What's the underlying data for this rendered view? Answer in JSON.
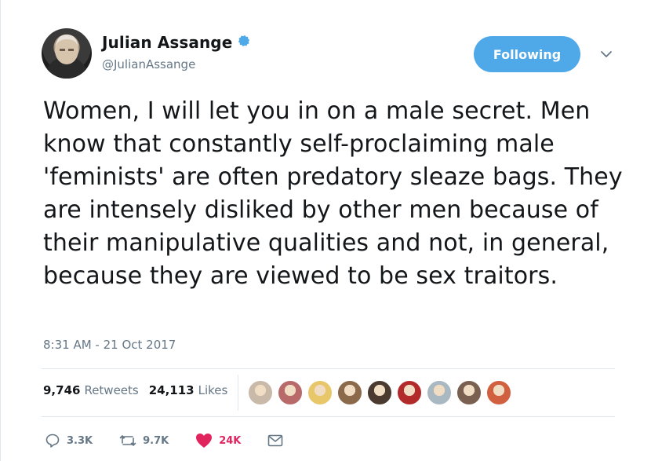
{
  "user": {
    "display_name": "Julian Assange",
    "handle": "@JulianAssange",
    "verified_icon": "verified-badge-icon"
  },
  "header": {
    "follow_label": "Following",
    "menu_icon": "chevron-down-icon"
  },
  "tweet": {
    "text": "Women, I will let you in on a male secret. Men know that constantly self-proclaiming male 'feminists' are often predatory sleaze bags. They are intensely disliked by other men because of their manipulative qualities and not, in general, because they are viewed to be sex traitors.",
    "timestamp": "8:31 AM - 21 Oct 2017"
  },
  "stats": {
    "retweets_count": "9,746",
    "retweets_label": "Retweets",
    "likes_count": "24,113",
    "likes_label": "Likes"
  },
  "likers": [
    {
      "name": "liker-avatar-1",
      "color": "#c9b9a8"
    },
    {
      "name": "liker-avatar-2",
      "color": "#b86a6a"
    },
    {
      "name": "liker-avatar-3",
      "color": "#e8c66a"
    },
    {
      "name": "liker-avatar-4",
      "color": "#8a6a4a"
    },
    {
      "name": "liker-avatar-5",
      "color": "#4a3a30"
    },
    {
      "name": "liker-avatar-6",
      "color": "#b32a2a"
    },
    {
      "name": "liker-avatar-7",
      "color": "#aab8c2"
    },
    {
      "name": "liker-avatar-8",
      "color": "#7a6050"
    },
    {
      "name": "liker-avatar-9",
      "color": "#d06040"
    }
  ],
  "actions": {
    "reply_count": "3.3K",
    "retweet_count": "9.7K",
    "like_count": "24K"
  },
  "colors": {
    "accent": "#4fa8e8",
    "like": "#e0245e",
    "muted": "#657786",
    "text": "#14171a"
  }
}
